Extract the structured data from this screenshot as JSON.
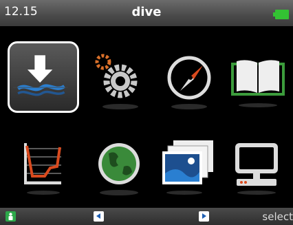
{
  "status": {
    "time": "12.15",
    "title": "dive"
  },
  "bottom": {
    "select_label": "select"
  },
  "menu": [
    {
      "name": "dive-icon"
    },
    {
      "name": "settings-icon"
    },
    {
      "name": "compass-icon"
    },
    {
      "name": "logbook-icon"
    },
    {
      "name": "profile-graph-icon"
    },
    {
      "name": "globe-icon"
    },
    {
      "name": "pictures-icon"
    },
    {
      "name": "pc-connect-icon"
    }
  ],
  "colors": {
    "accent": "#2da84a",
    "battery": "#33c233",
    "nav_blue": "#1f5fb3"
  }
}
